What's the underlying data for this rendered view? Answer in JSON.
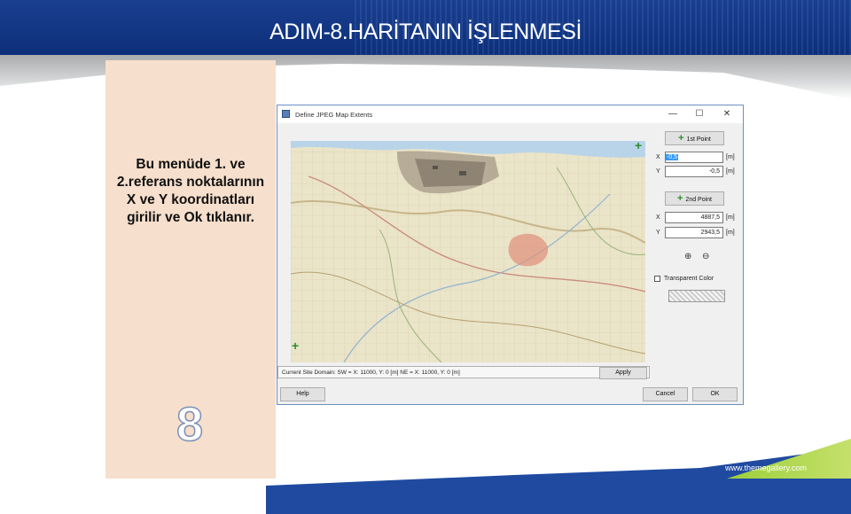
{
  "slide": {
    "title": "ADIM-8.HARİTANIN İŞLENMESİ",
    "panel_text": "Bu menüde 1. ve 2.referans noktalarının X ve Y koordinatları girilir ve Ok tıklanır.",
    "slide_number": "8",
    "footer_url": "www.themegallery.com"
  },
  "dialog": {
    "title": "Define JPEG Map Extents",
    "window_buttons": {
      "minimize": "—",
      "maximize": "☐",
      "close": "✕"
    },
    "first_point": {
      "button_label": "1st Point",
      "x_label": "X",
      "x_value": "-0,5",
      "y_label": "Y",
      "y_value": "-0,5",
      "unit": "[m]"
    },
    "second_point": {
      "button_label": "2nd Point",
      "x_label": "X",
      "x_value": "4887,5",
      "y_label": "Y",
      "y_value": "2943,5",
      "unit": "[m]"
    },
    "zoom_in_symbol": "⊕",
    "zoom_out_symbol": "⊖",
    "transparent_color_label": "Transparent Color",
    "transparent_color_checked": false,
    "status_text": "Current Site Domain:   SW = X: 11000, Y: 0 [m]   NE = X: 11000, Y: 0 [m]",
    "apply_label": "Apply",
    "help_label": "Help",
    "cancel_label": "Cancel",
    "ok_label": "OK",
    "cross_symbol": "+"
  },
  "colors": {
    "header_blue": "#13347f",
    "panel_peach": "#f6dfcc",
    "cross_green": "#2d8a2d",
    "selection_blue": "#3399ff"
  }
}
